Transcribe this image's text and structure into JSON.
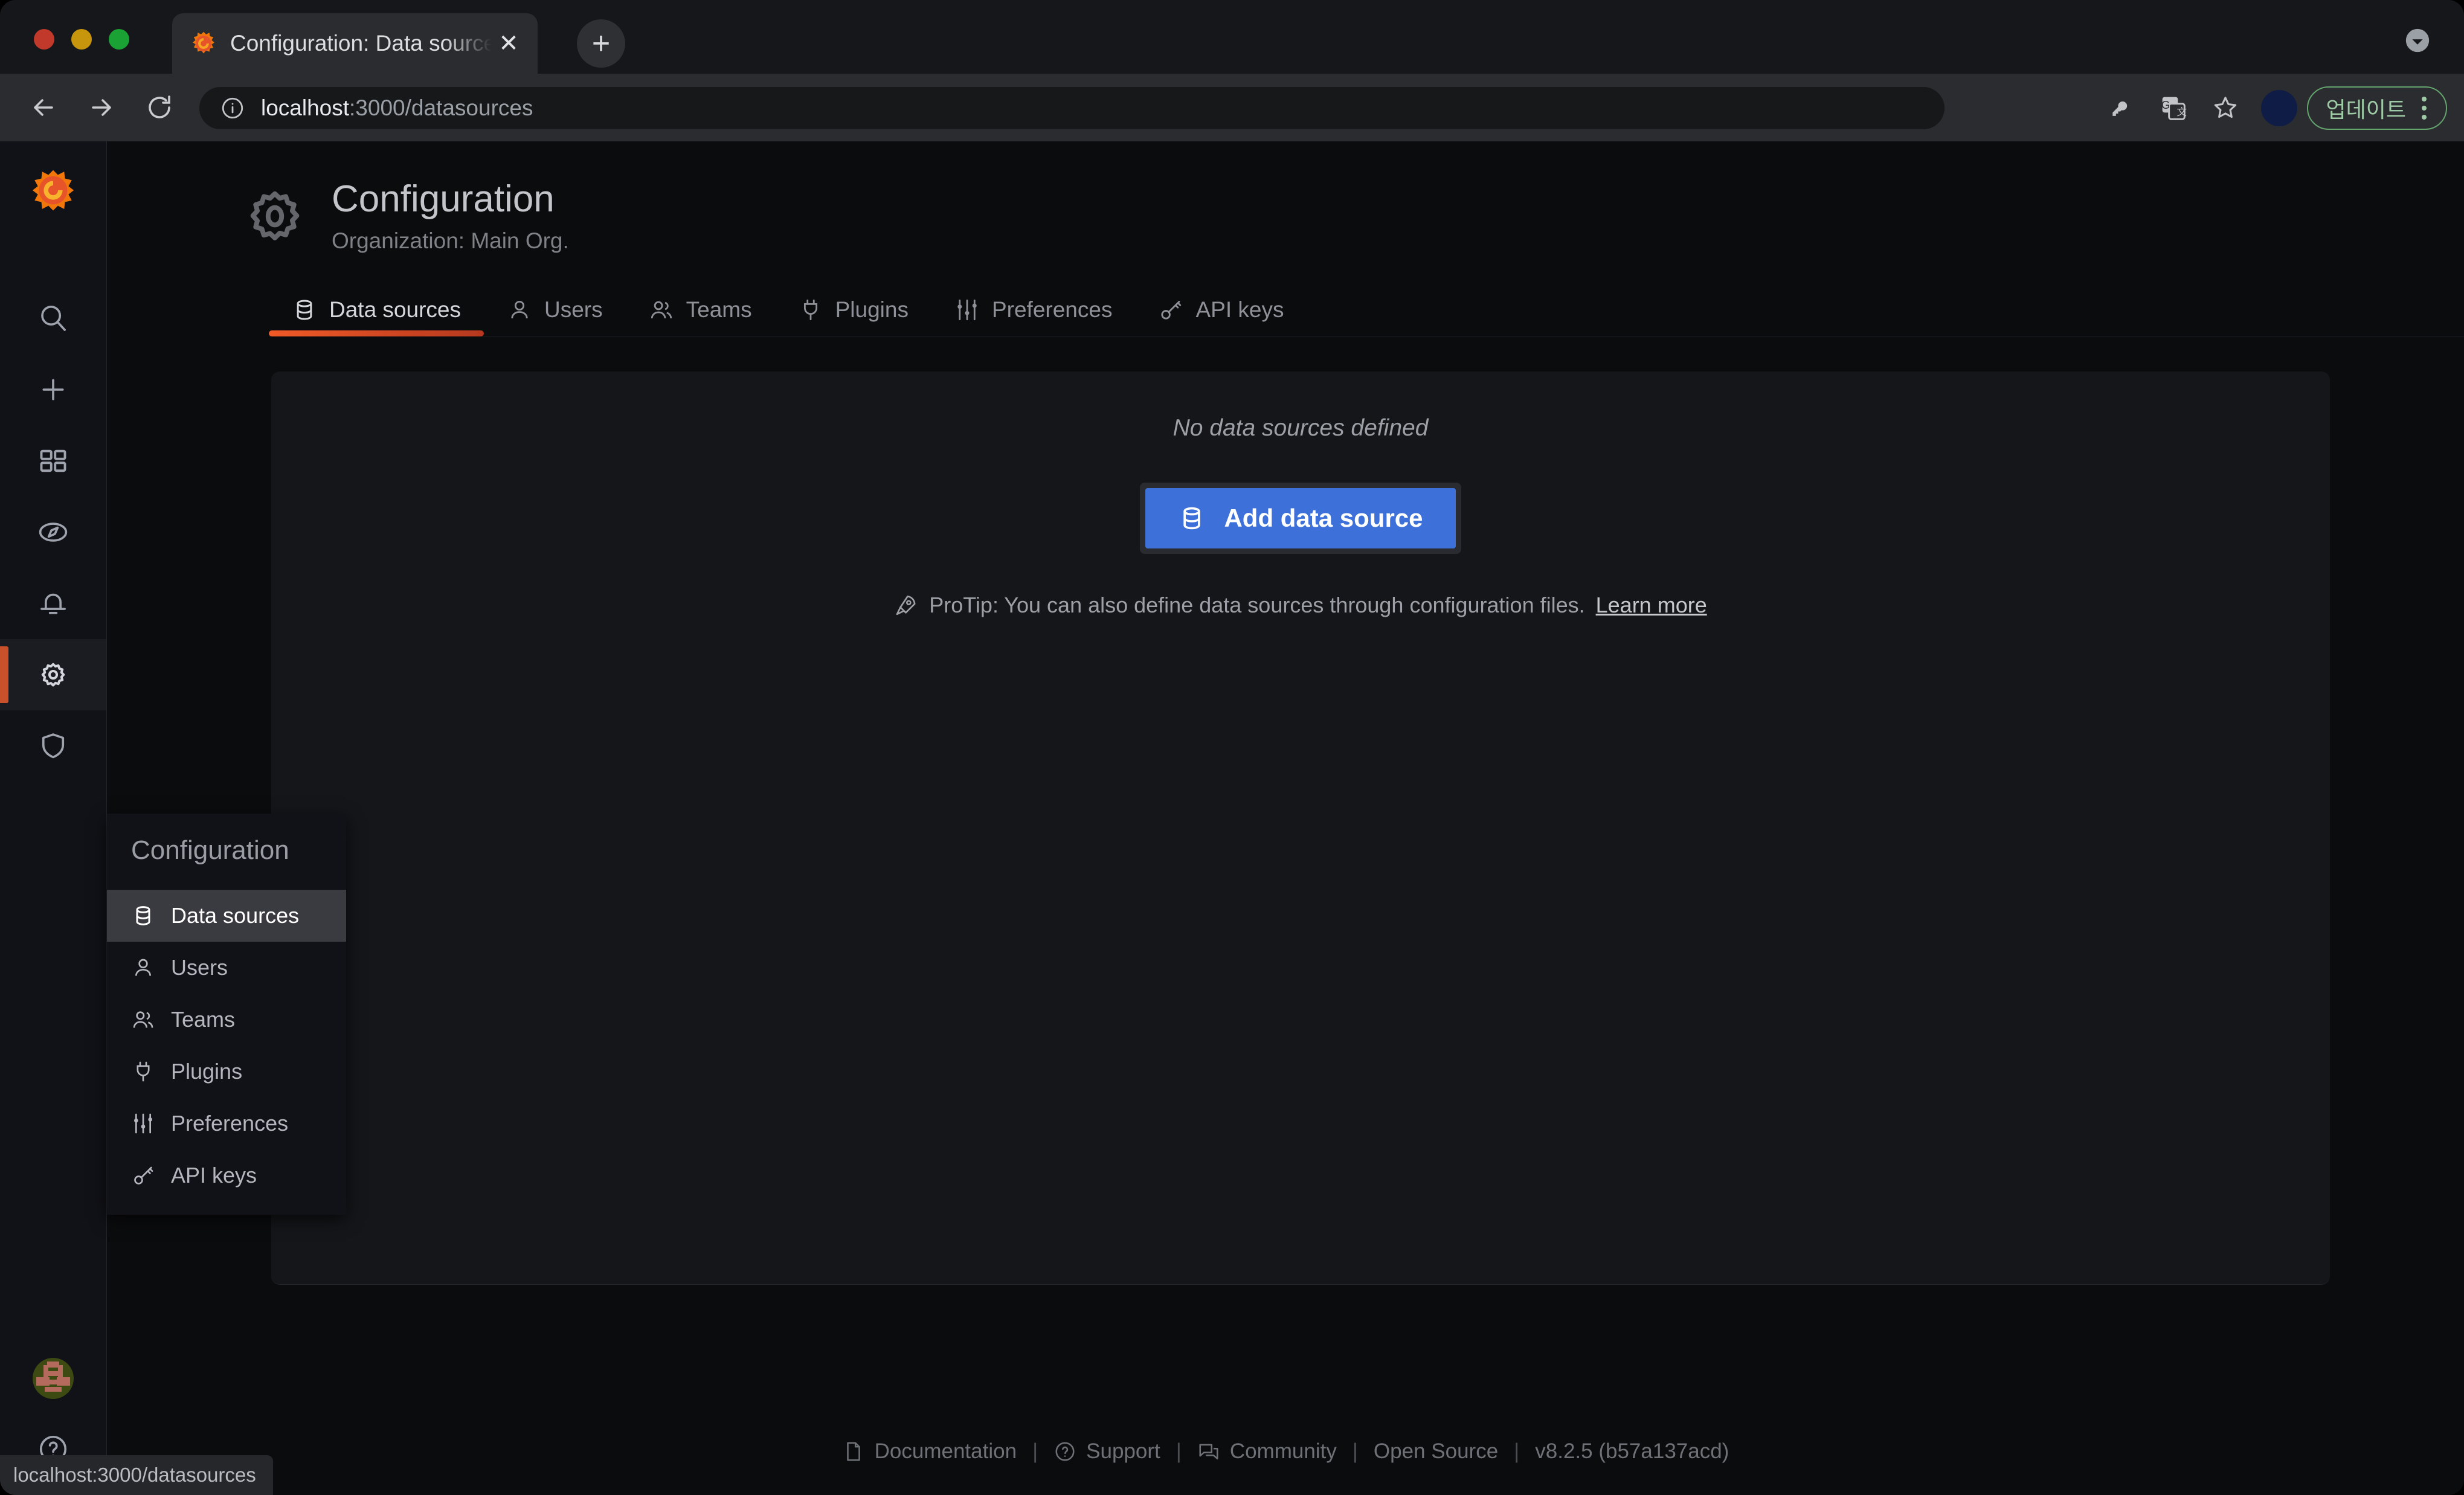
{
  "browser": {
    "tab": {
      "title": "Configuration: Data sources - G",
      "favicon": "grafana-logo-icon",
      "close_icon": "close-icon"
    },
    "new_tab_label": "+",
    "nav": {
      "back_icon": "arrow-left-icon",
      "forward_icon": "arrow-right-icon",
      "reload_icon": "reload-icon"
    },
    "omnibox": {
      "info_icon": "info-circle-icon",
      "url_host": "localhost",
      "url_path": ":3000/datasources",
      "full_url": "localhost:3000/datasources"
    },
    "toolbar_icons": [
      "key-icon",
      "translate-icon",
      "bookmark-star-icon"
    ],
    "profile_avatar": "chrome-profile-avatar",
    "update_button_label": "업데이트",
    "menu_icon": "kebab-menu-icon",
    "tabstrip_right_icon": "chevron-down-circle-icon"
  },
  "rail": {
    "logo": "grafana-logo",
    "items": [
      {
        "name": "search",
        "icon": "search-icon",
        "active": false
      },
      {
        "name": "create",
        "icon": "plus-icon",
        "active": false
      },
      {
        "name": "dashboards",
        "icon": "apps-grid-icon",
        "active": false
      },
      {
        "name": "explore",
        "icon": "compass-icon",
        "active": false
      },
      {
        "name": "alerting",
        "icon": "bell-icon",
        "active": false
      },
      {
        "name": "configuration",
        "icon": "gear-icon",
        "active": true
      },
      {
        "name": "server-admin",
        "icon": "shield-icon",
        "active": false
      }
    ],
    "bottom": [
      {
        "name": "user-avatar",
        "icon": "avatar-identicon"
      },
      {
        "name": "help",
        "icon": "question-circle-icon"
      }
    ]
  },
  "header": {
    "icon": "gear-icon",
    "title": "Configuration",
    "subtitle": "Organization: Main Org."
  },
  "tabs": [
    {
      "label": "Data sources",
      "icon": "database-icon",
      "active": true
    },
    {
      "label": "Users",
      "icon": "user-icon",
      "active": false
    },
    {
      "label": "Teams",
      "icon": "users-alt-icon",
      "active": false
    },
    {
      "label": "Plugins",
      "icon": "plug-icon",
      "active": false
    },
    {
      "label": "Preferences",
      "icon": "sliders-icon",
      "active": false
    },
    {
      "label": "API keys",
      "icon": "key-skeleton-icon",
      "active": false
    }
  ],
  "main": {
    "empty_message": "No data sources defined",
    "add_button_label": "Add data source",
    "add_button_icon": "database-icon",
    "protip_icon": "rocket-icon",
    "protip_text": "ProTip: You can also define data sources through configuration files.",
    "protip_link": "Learn more"
  },
  "flyout": {
    "title": "Configuration",
    "items": [
      {
        "label": "Data sources",
        "icon": "database-icon",
        "active": true
      },
      {
        "label": "Users",
        "icon": "user-icon",
        "active": false
      },
      {
        "label": "Teams",
        "icon": "users-alt-icon",
        "active": false
      },
      {
        "label": "Plugins",
        "icon": "plug-icon",
        "active": false
      },
      {
        "label": "Preferences",
        "icon": "sliders-icon",
        "active": false
      },
      {
        "label": "API keys",
        "icon": "key-skeleton-icon",
        "active": false
      }
    ]
  },
  "footer": {
    "items": [
      {
        "label": "Documentation",
        "icon": "document-icon"
      },
      {
        "label": "Support",
        "icon": "question-circle-icon"
      },
      {
        "label": "Community",
        "icon": "comments-icon"
      },
      {
        "label": "Open Source",
        "icon": ""
      }
    ],
    "separator": "|",
    "version": "v8.2.5 (b57a137acd)"
  },
  "status_bar": {
    "url": "localhost:3000/datasources"
  },
  "colors": {
    "accent_orange": "#f05a28",
    "primary_blue": "#3d71d9",
    "update_green": "#64a46f",
    "panel_bg": "#141619",
    "app_bg": "#0b0c0e"
  }
}
